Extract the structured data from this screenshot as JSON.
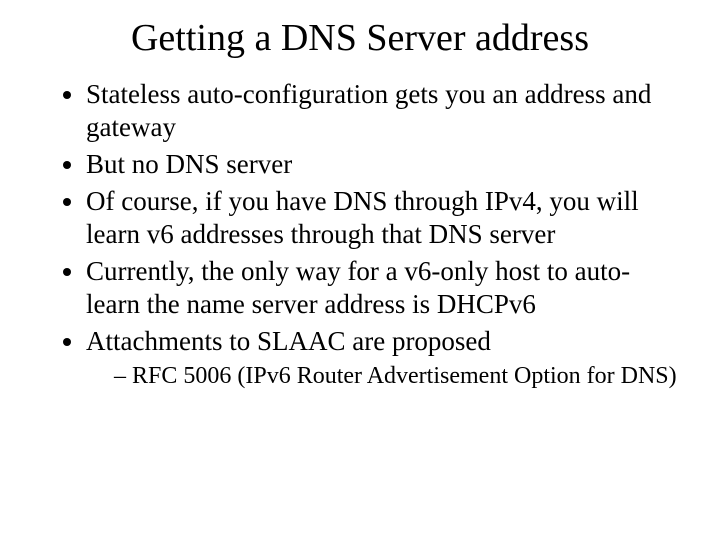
{
  "title": "Getting a DNS Server address",
  "bullets": {
    "b1": "Stateless auto-configuration gets you an address and gateway",
    "b2": "But no DNS server",
    "b3": "Of course, if you have DNS through IPv4, you will learn v6 addresses through that DNS server",
    "b4": "Currently, the only way for a v6-only host to auto-learn the name server address is DHCPv6",
    "b5": " Attachments to SLAAC are proposed"
  },
  "sub": {
    "s1": "RFC 5006 (IPv6 Router Advertisement Option for DNS)"
  }
}
